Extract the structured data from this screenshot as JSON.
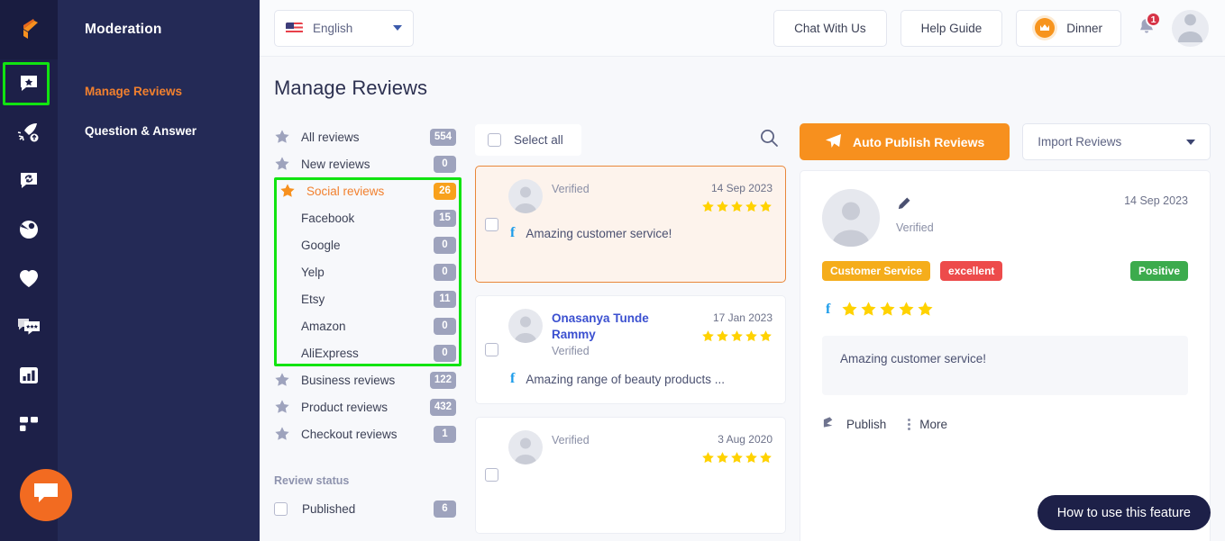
{
  "rail": {
    "logo_icon": "logo-icon",
    "items": [
      {
        "icon": "review-chat-star-icon",
        "name": "reviews",
        "selected": true
      },
      {
        "icon": "rocket-upload-icon",
        "name": "campaigns",
        "selected": false
      },
      {
        "icon": "chat-refresh-icon",
        "name": "sync",
        "selected": false
      },
      {
        "icon": "pie-chart-icon",
        "name": "analytics-pie",
        "selected": false
      },
      {
        "icon": "heart-icon",
        "name": "favorites",
        "selected": false
      },
      {
        "icon": "review-cards-icon",
        "name": "widgets",
        "selected": false
      },
      {
        "icon": "bar-chart-icon",
        "name": "reports",
        "selected": false
      },
      {
        "icon": "grid-apps-icon",
        "name": "apps",
        "selected": false
      }
    ],
    "chat_icon": "chat-bubble-icon"
  },
  "nav": {
    "title": "Moderation",
    "links": [
      {
        "label": "Manage Reviews",
        "active": true
      },
      {
        "label": "Question & Answer",
        "active": false
      }
    ]
  },
  "topbar": {
    "language": "English",
    "language_flag": "us-flag-icon",
    "chat_with_us": "Chat With Us",
    "help_guide": "Help Guide",
    "plan_label": "Dinner",
    "plan_icon": "crown-icon",
    "notification_icon": "bell-icon",
    "notification_count": "1",
    "avatar_icon": "user-avatar-icon"
  },
  "page": {
    "title": "Manage Reviews"
  },
  "filters": {
    "groups": [
      {
        "label": "All reviews",
        "count": "554",
        "icon": "star-icon",
        "active": false,
        "sub": false
      },
      {
        "label": "New reviews",
        "count": "0",
        "icon": "star-icon",
        "active": false,
        "sub": false
      }
    ],
    "social": {
      "parent": {
        "label": "Social reviews",
        "count": "26",
        "icon": "star-icon",
        "active": true
      },
      "children": [
        {
          "label": "Facebook",
          "count": "15"
        },
        {
          "label": "Google",
          "count": "0"
        },
        {
          "label": "Yelp",
          "count": "0"
        },
        {
          "label": "Etsy",
          "count": "11"
        },
        {
          "label": "Amazon",
          "count": "0"
        },
        {
          "label": "AliExpress",
          "count": "0"
        }
      ]
    },
    "rest": [
      {
        "label": "Business reviews",
        "count": "122",
        "icon": "star-icon"
      },
      {
        "label": "Product reviews",
        "count": "432",
        "icon": "star-icon"
      },
      {
        "label": "Checkout reviews",
        "count": "1",
        "icon": "star-icon"
      }
    ],
    "status_title": "Review status",
    "status_items": [
      {
        "label": "Published",
        "count": "6",
        "checked": false
      }
    ]
  },
  "list": {
    "select_all_label": "Select all",
    "search_icon": "search-icon",
    "cards": [
      {
        "name": "",
        "verified": "Verified",
        "date": "14 Sep 2023",
        "stars": 5,
        "source_icon": "facebook-icon",
        "text": "Amazing customer service!",
        "selected": true,
        "checked": false
      },
      {
        "name": "Onasanya Tunde Rammy",
        "verified": "Verified",
        "date": "17 Jan 2023",
        "stars": 5,
        "source_icon": "facebook-icon",
        "text": "Amazing range of beauty products ...",
        "selected": false,
        "checked": false
      },
      {
        "name": "",
        "verified": "Verified",
        "date": "3 Aug 2020",
        "stars": 5,
        "source_icon": "facebook-icon",
        "text": "",
        "selected": false,
        "checked": false
      }
    ]
  },
  "detail": {
    "auto_publish_label": "Auto Publish Reviews",
    "auto_publish_icon": "send-plane-icon",
    "import_label": "Import Reviews",
    "edit_icon": "pencil-icon",
    "verified": "Verified",
    "date": "14 Sep 2023",
    "tags": [
      {
        "label": "Customer Service",
        "color": "#f5ad1b"
      },
      {
        "label": "excellent",
        "color": "#ed4b4b"
      }
    ],
    "sentiment": {
      "label": "Positive",
      "color": "#3cab4d"
    },
    "source_icon": "facebook-icon",
    "stars": 5,
    "review_text": "Amazing customer service!",
    "publish_label": "Publish",
    "publish_icon": "publish-flag-icon",
    "more_label": "More",
    "more_icon": "kebab-menu-icon"
  },
  "howto": {
    "label": "How to use this feature"
  },
  "colors": {
    "brand_orange": "#f7901e",
    "rail_bg": "#1d2048",
    "nav_bg": "#242a56",
    "highlight_green": "#11e311",
    "star_yellow": "#ffd200",
    "badge_gray": "#9ea3bd"
  }
}
